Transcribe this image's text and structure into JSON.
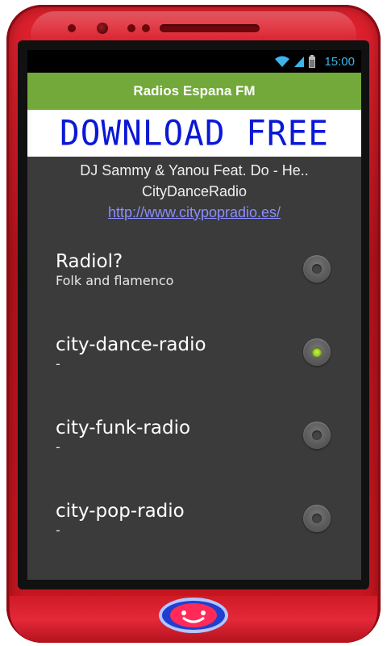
{
  "statusbar": {
    "time": "15:00",
    "icons": [
      "wifi-icon",
      "signal-icon",
      "battery-icon"
    ]
  },
  "app": {
    "title": "Radios Espana FM"
  },
  "banner": {
    "text": "DOWNLOAD FREE"
  },
  "now_playing": {
    "track": "DJ Sammy & Yanou Feat. Do - He..",
    "station": "CityDanceRadio",
    "url": "http://www.citypopradio.es/"
  },
  "stations": [
    {
      "title": "Radiol?",
      "subtitle": "Folk and flamenco",
      "selected": false
    },
    {
      "title": "city-dance-radio",
      "subtitle": "-",
      "selected": true
    },
    {
      "title": "city-funk-radio",
      "subtitle": "-",
      "selected": false
    },
    {
      "title": "city-pop-radio",
      "subtitle": "-",
      "selected": false
    }
  ],
  "colors": {
    "titlebar": "#72a93a",
    "banner_text": "#0a18d6",
    "clock": "#3fb4e8",
    "link": "#8a8dff",
    "phone_frame": "#c8161f"
  }
}
